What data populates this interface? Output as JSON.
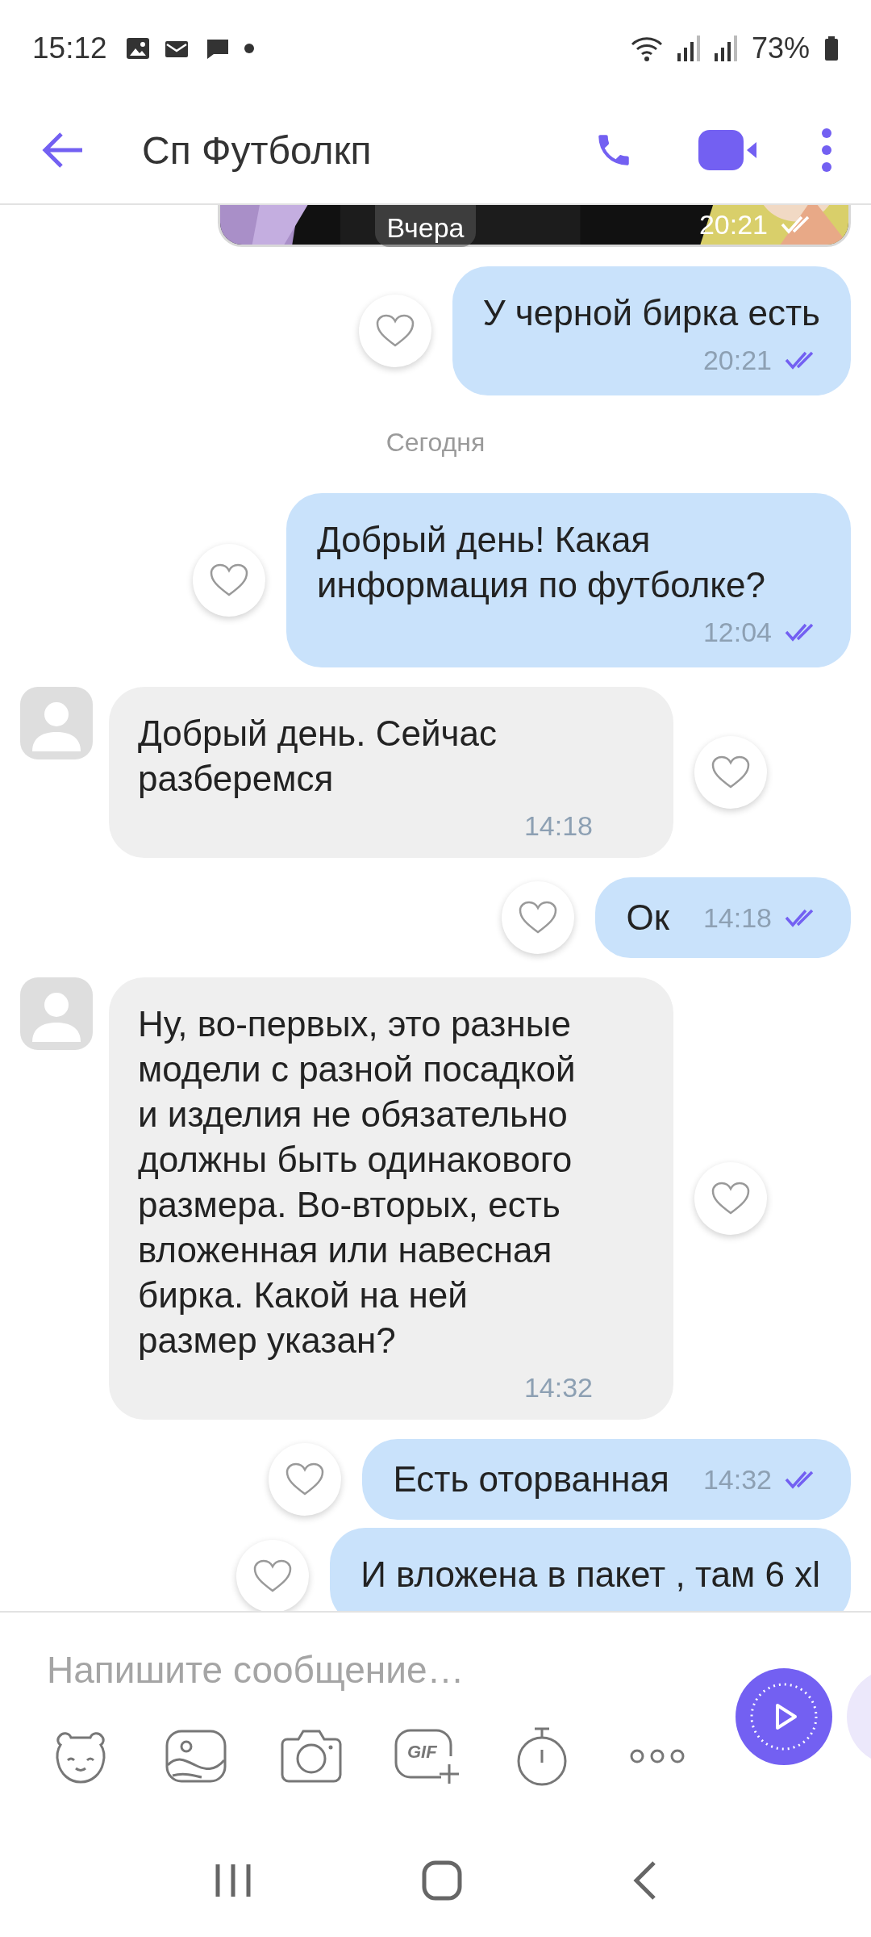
{
  "status_bar": {
    "time": "15:12",
    "battery": "73%"
  },
  "header": {
    "title": "Сп Футболкп"
  },
  "floating_date": "Вчера",
  "messages": [
    {
      "time": "20:21",
      "read": true
    },
    {
      "kind": "outgoing",
      "text": "У черной бирка есть",
      "time": "20:21",
      "read": true,
      "time_inline": false
    },
    {
      "kind": "date",
      "text": "Сегодня"
    },
    {
      "kind": "outgoing",
      "text": "Добрый день! Какая информация по футболке?",
      "time": "12:04",
      "read": true,
      "time_inline": false
    },
    {
      "kind": "incoming",
      "text": "Добрый день. Сейчас разберемся",
      "time": "14:18"
    },
    {
      "kind": "outgoing",
      "text": "Ок",
      "time": "14:18",
      "read": true,
      "time_inline": true
    },
    {
      "kind": "incoming",
      "text": "Ну, во-первых, это разные модели с разной посадкой и изделия не обязательно должны быть одинакового размера. Во-вторых, есть вложенная или навесная бирка. Какой на ней размер указан?",
      "time": "14:32"
    },
    {
      "kind": "outgoing",
      "text": "Есть оторванная",
      "time": "14:32",
      "read": true,
      "time_inline": true
    },
    {
      "kind": "outgoing",
      "text": "И вложена в пакет , там 6 xl"
    }
  ],
  "composer": {
    "placeholder": "Напишите сообщение…"
  },
  "toolbar": [
    {
      "kind": "sticker"
    },
    {
      "kind": "gallery"
    },
    {
      "kind": "camera"
    },
    {
      "kind": "gif",
      "label": "GIF"
    },
    {
      "kind": "timer"
    },
    {
      "kind": "more"
    }
  ]
}
